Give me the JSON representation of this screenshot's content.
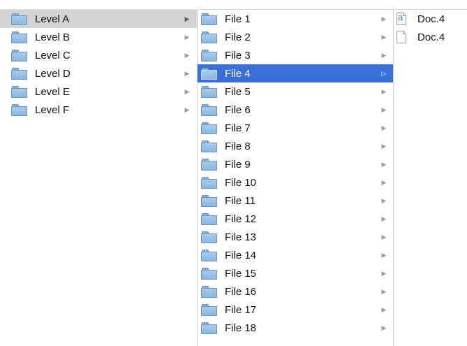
{
  "column1": {
    "items": [
      {
        "label": "Level A",
        "state": "selected-inactive"
      },
      {
        "label": "Level B"
      },
      {
        "label": "Level C"
      },
      {
        "label": "Level D"
      },
      {
        "label": "Level E"
      },
      {
        "label": "Level F"
      }
    ],
    "icon": "folder-icon",
    "arrow_glyph": "▶"
  },
  "column2": {
    "items": [
      {
        "label": "File 1"
      },
      {
        "label": "File 2"
      },
      {
        "label": "File 3"
      },
      {
        "label": "File 4",
        "state": "selected-active"
      },
      {
        "label": "File 5"
      },
      {
        "label": "File 6"
      },
      {
        "label": "File 7"
      },
      {
        "label": "File 8"
      },
      {
        "label": "File 9"
      },
      {
        "label": "File 10"
      },
      {
        "label": "File 11"
      },
      {
        "label": "File 12"
      },
      {
        "label": "File 13"
      },
      {
        "label": "File 14"
      },
      {
        "label": "File 15"
      },
      {
        "label": "File 16"
      },
      {
        "label": "File 17"
      },
      {
        "label": "File 18"
      }
    ],
    "icon": "folder-icon",
    "arrow_glyph": "▶",
    "active_arrow_glyph": "▷"
  },
  "column3": {
    "items": [
      {
        "label": "Doc.4",
        "icon": "text-document-icon",
        "glyph": "a"
      },
      {
        "label": "Doc.4",
        "icon": "blank-document-icon",
        "glyph": ""
      }
    ]
  },
  "colors": {
    "selection_active": "#3a6fd8",
    "selection_inactive": "#d4d4d4",
    "folder": "#9cc0e6"
  }
}
